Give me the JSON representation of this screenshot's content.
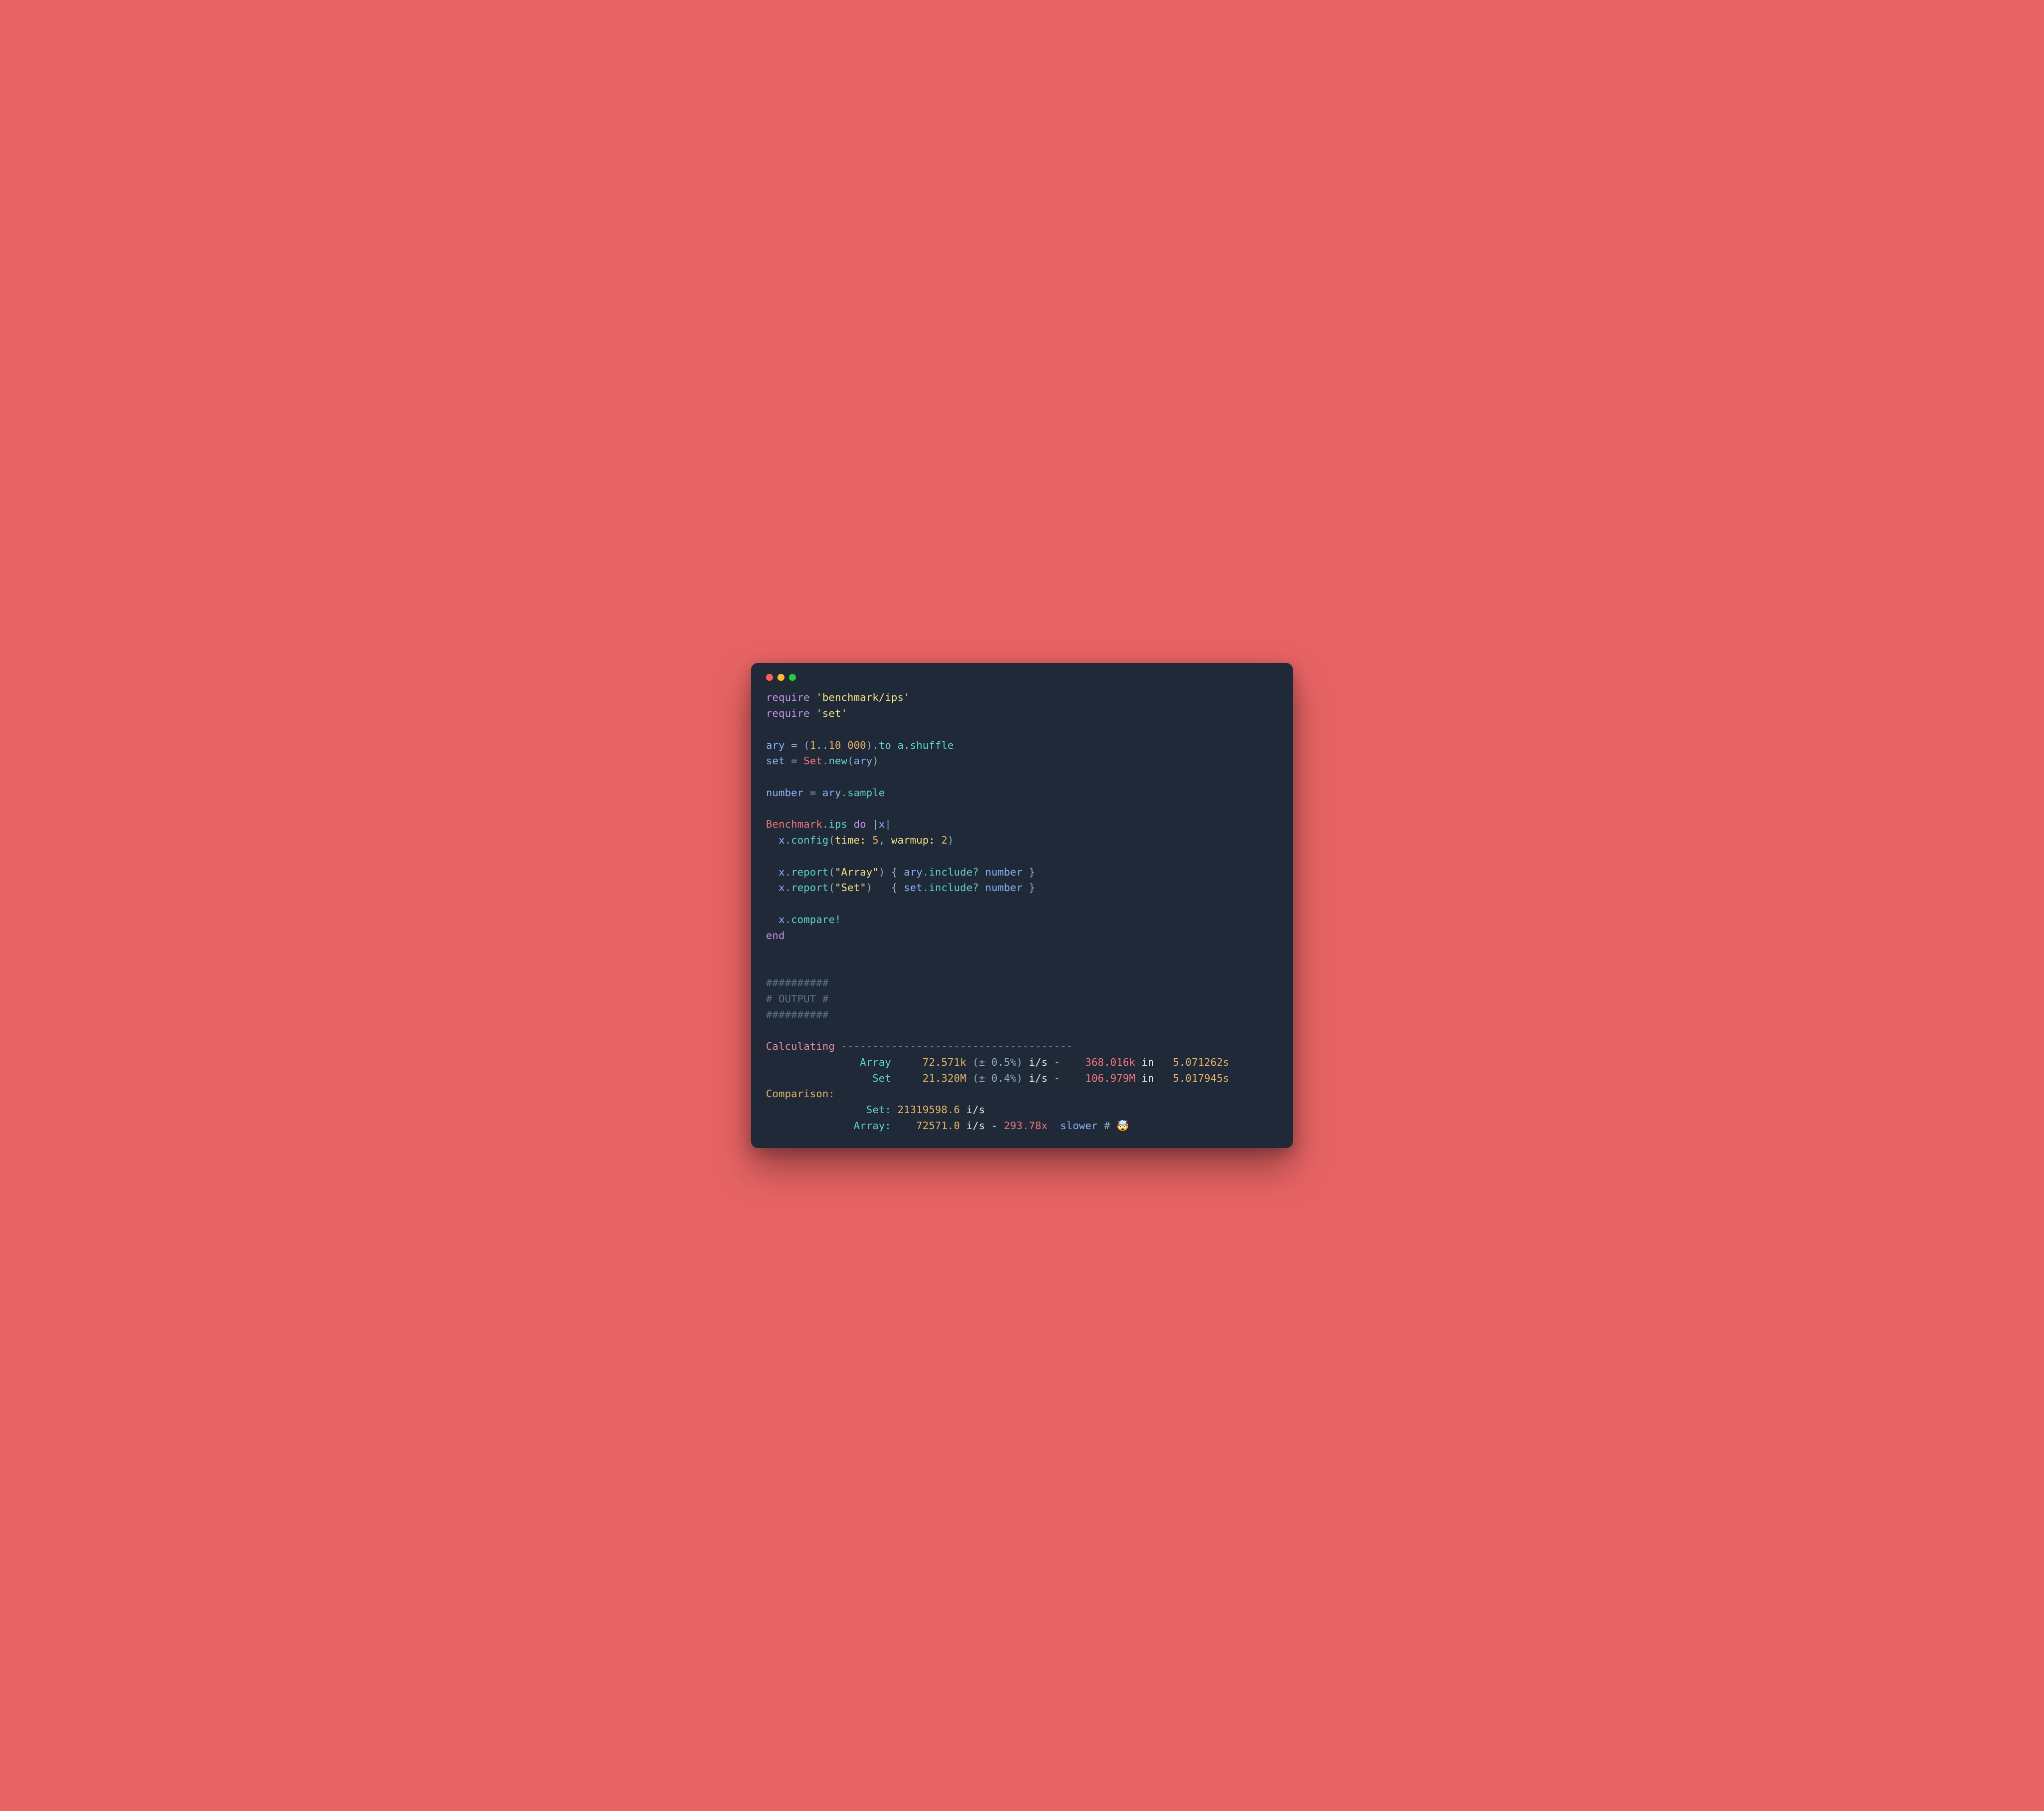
{
  "code": {
    "line01": {
      "kw": "require",
      "sp": " ",
      "q1": "'",
      "str": "benchmark/ips",
      "q2": "'"
    },
    "line02": {
      "kw": "require",
      "sp": " ",
      "q1": "'",
      "str": "set",
      "q2": "'"
    },
    "line03": {
      "var1": "ary",
      "sp1": " ",
      "eq": "=",
      "sp2": " ",
      "op": "(",
      "n1": "1",
      "dots": "..",
      "n2": "10_000",
      "cp": ")",
      "d1": ".",
      "fn1": "to_a",
      "d2": ".",
      "fn2": "shuffle"
    },
    "line04": {
      "var1": "set",
      "sp1": " ",
      "eq": "=",
      "sp2": " ",
      "const": "Set",
      "d1": ".",
      "fn1": "new",
      "op": "(",
      "arg": "ary",
      "cp": ")"
    },
    "line05": {
      "var1": "number",
      "sp1": " ",
      "eq": "=",
      "sp2": " ",
      "var2": "ary",
      "d1": ".",
      "fn1": "sample"
    },
    "line06": {
      "const": "Benchmark",
      "d1": ".",
      "fn1": "ips",
      "sp1": " ",
      "kw1": "do",
      "sp2": " ",
      "p1": "|",
      "var": "x",
      "p2": "|"
    },
    "line07": {
      "indent": "  ",
      "var": "x",
      "d1": ".",
      "fn1": "config",
      "op": "(",
      "sym1": "time:",
      "sp1": " ",
      "n1": "5",
      "c1": ",",
      "sp2": " ",
      "sym2": "warmup:",
      "sp3": " ",
      "n2": "2",
      "cp": ")"
    },
    "line08": {
      "indent": "  ",
      "var": "x",
      "d1": ".",
      "fn1": "report",
      "op": "(",
      "q1": "\"",
      "str": "Array",
      "q2": "\"",
      "cp": ")",
      "sp1": " ",
      "ob": "{",
      "sp2": " ",
      "var2": "ary",
      "d2": ".",
      "fn2": "include?",
      "sp3": " ",
      "var3": "number",
      "sp4": " ",
      "cb": "}"
    },
    "line09": {
      "indent": "  ",
      "var": "x",
      "d1": ".",
      "fn1": "report",
      "op": "(",
      "q1": "\"",
      "str": "Set",
      "q2": "\"",
      "cp": ")",
      "sp1": "   ",
      "ob": "{",
      "sp2": " ",
      "var2": "set",
      "d2": ".",
      "fn2": "include?",
      "sp3": " ",
      "var3": "number",
      "sp4": " ",
      "cb": "}"
    },
    "line10": {
      "indent": "  ",
      "var": "x",
      "d1": ".",
      "fn1": "compare!"
    },
    "line11": {
      "kw": "end"
    }
  },
  "comments": {
    "c1": "##########",
    "c2": "# OUTPUT #",
    "c3": "##########"
  },
  "output": {
    "calc_label": "Calculating",
    "calc_dashes": " -------------------------------------",
    "row1": {
      "name": "Array",
      "rate": "72.571k",
      "stddev": "(± 0.5%)",
      "unit": " i/s -",
      "iters": "368.016k",
      "in": " in",
      "time": "5.071262s"
    },
    "row2": {
      "name": "Set",
      "rate": "21.320M",
      "stddev": "(± 0.4%)",
      "unit": " i/s -",
      "iters": "106.979M",
      "in": " in",
      "time": "5.017945s"
    },
    "comparison_label": "Comparison:",
    "cmp1": {
      "name": "Set:",
      "rate": "21319598.6",
      "unit": " i/s"
    },
    "cmp2": {
      "name": "Array:",
      "rate": "72571.0",
      "unit": " i/s - ",
      "mult": "293.78x",
      "slower": "  slower ",
      "hash": "# ",
      "emoji": "🤯"
    }
  }
}
